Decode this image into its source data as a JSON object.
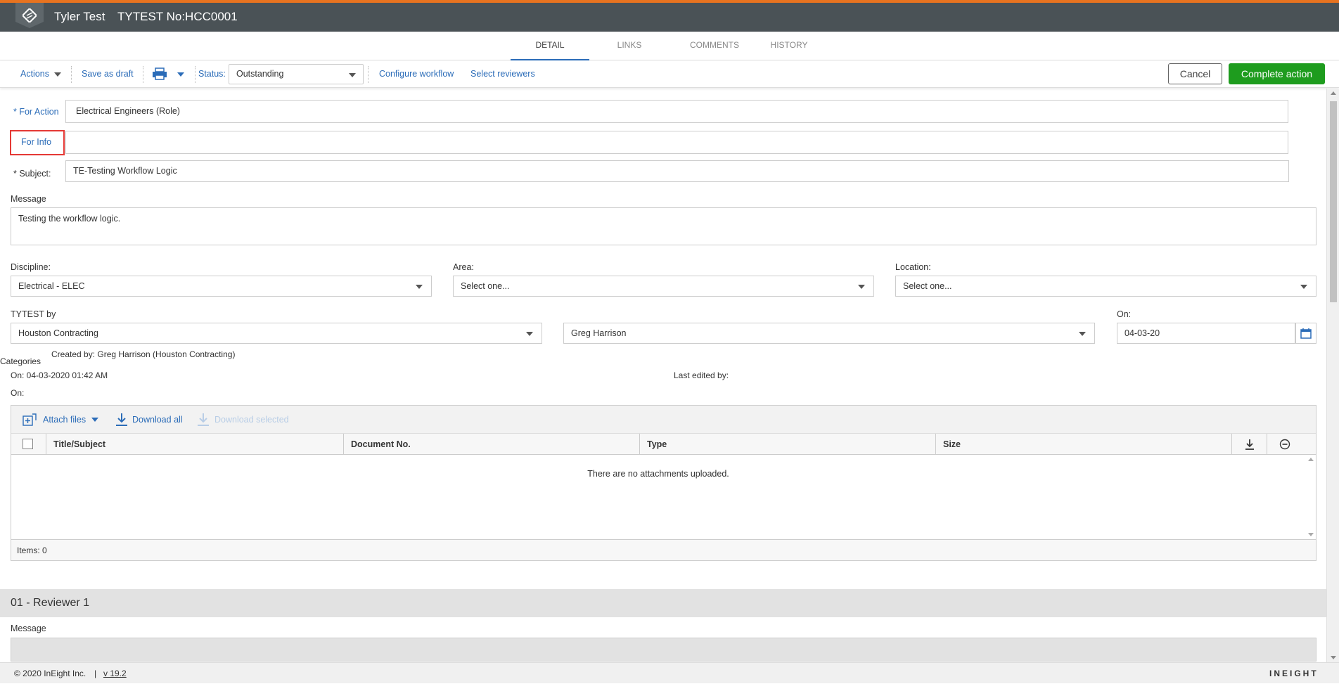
{
  "header": {
    "user_name": "Tyler Test",
    "document_title": "TYTEST No:HCC0001"
  },
  "tabs": [
    "DETAIL",
    "LINKS",
    "COMMENTS",
    "HISTORY"
  ],
  "toolbar": {
    "actions_label": "Actions",
    "save_draft_label": "Save as draft",
    "status_label": "Status:",
    "status_value": "Outstanding",
    "configure_workflow_label": "Configure workflow",
    "select_reviewers_label": "Select reviewers",
    "cancel_label": "Cancel",
    "complete_label": "Complete action"
  },
  "form": {
    "for_action_label": "* For Action",
    "for_action_value": "Electrical Engineers (Role)",
    "for_info_label": "For Info",
    "for_info_value": "",
    "subject_label": "* Subject:",
    "subject_value": "TE-Testing Workflow Logic",
    "message_label": "Message",
    "message_value": "Testing the workflow logic.",
    "discipline_label": "Discipline:",
    "discipline_value": "Electrical - ELEC",
    "area_label": "Area:",
    "area_value": "Select one...",
    "location_label": "Location:",
    "location_value": "Select one...",
    "by_label": "TYTEST by",
    "by_company": "Houston Contracting",
    "by_person": "Greg Harrison",
    "on_label": "On:",
    "on_value": "04-03-20",
    "categories_label": "Categories",
    "created_by": "Created by: Greg Harrison (Houston Contracting)",
    "created_on": "On: 04-03-2020 01:42 AM",
    "last_edited_by": "Last edited by:",
    "edited_on": "On:"
  },
  "attachments": {
    "attach_label": "Attach files",
    "download_all_label": "Download all",
    "download_selected_label": "Download selected",
    "columns": [
      "Title/Subject",
      "Document No.",
      "Type",
      "Size"
    ],
    "empty_message": "There are no attachments uploaded.",
    "items_count": "Items: 0"
  },
  "reviewer": {
    "title": "01 - Reviewer 1",
    "message_label": "Message"
  },
  "footer": {
    "copyright": "© 2020 InEight Inc.",
    "separator": "|",
    "version": "v 19.2",
    "brand": "INEIGHT"
  },
  "colors": {
    "accent_orange": "#e8731f",
    "header_bg": "#4a5256",
    "link_blue": "#2b6cb8",
    "complete_green": "#1e9c1e",
    "highlight_red": "#e53935"
  }
}
